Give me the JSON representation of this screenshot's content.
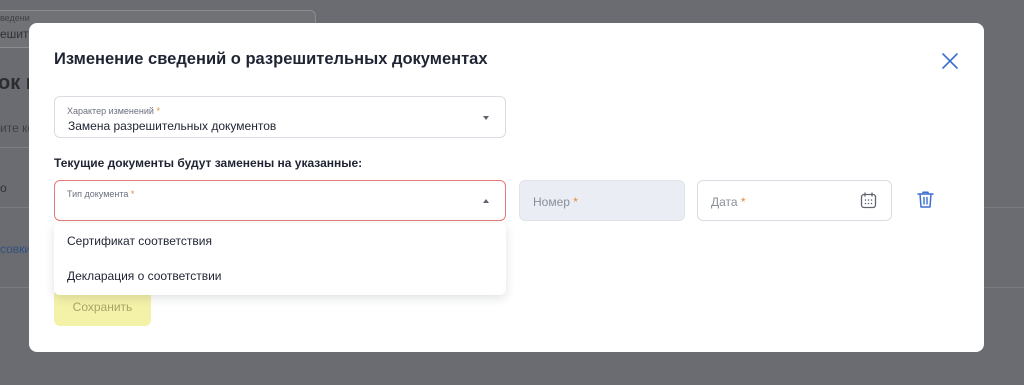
{
  "background": {
    "field_label": "ведени",
    "field_value": "ешите",
    "heading": "ок ко",
    "input_placeholder": "ите ко",
    "row_text": "о",
    "link_text": "совки"
  },
  "modal": {
    "title": "Изменение сведений о разрешительных документах",
    "change_type": {
      "label": "Характер изменений",
      "required_mark": "*",
      "value": "Замена разрешительных документов"
    },
    "section_label": "Текущие документы будут заменены на указанные:",
    "doc_type": {
      "label": "Тип документа",
      "required_mark": "*",
      "value": ""
    },
    "number": {
      "placeholder": "Номер",
      "required_mark": "*"
    },
    "date": {
      "placeholder": "Дата",
      "required_mark": "*"
    },
    "dropdown_options": [
      "Сертификат соответствия",
      "Декларация о соответствии"
    ],
    "save_label": "Сохранить"
  },
  "colors": {
    "accent": "#3b6fd1",
    "error_border": "#e57a7a",
    "required": "#e38a3a",
    "save_bg": "#f4f2a8"
  },
  "icons": {
    "close": "close-icon",
    "calendar": "calendar-icon",
    "trash": "trash-icon"
  }
}
